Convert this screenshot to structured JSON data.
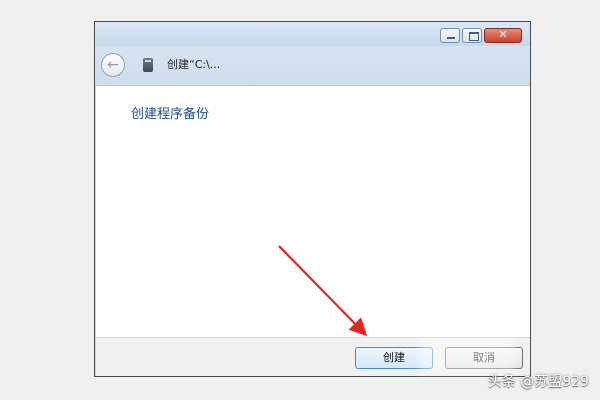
{
  "window": {
    "nav_title": "创建“C:\\...",
    "content_heading": "创建程序备份",
    "create_button": "创建",
    "cancel_button": "取消"
  },
  "titlebar": {
    "close_label": "✕"
  },
  "watermark": "头条 @苏盟929"
}
